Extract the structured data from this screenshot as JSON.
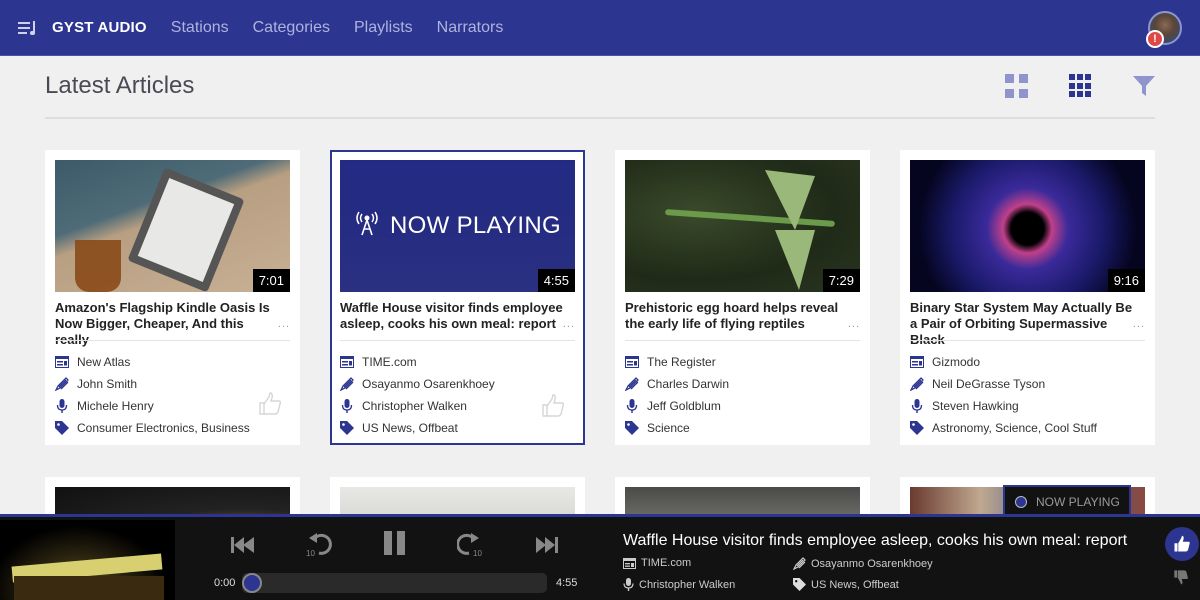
{
  "nav": {
    "brand": "GYST AUDIO",
    "links": [
      "Stations",
      "Categories",
      "Playlists",
      "Narrators"
    ],
    "avatar_alert": "!"
  },
  "page": {
    "title": "Latest Articles"
  },
  "colors": {
    "brand": "#2c3590",
    "nav_link": "#aeb3de",
    "alert": "#e04848"
  },
  "cards": [
    {
      "duration": "7:01",
      "title": "Amazon's Flagship Kindle Oasis Is Now Bigger, Cheaper, And this really",
      "publisher": "New Atlas",
      "author": "John Smith",
      "narrator": "Michele Henry",
      "tags": "Consumer Electronics, Business",
      "ellipsis": "..."
    },
    {
      "duration": "4:55",
      "title": "Waffle House visitor finds employee asleep, cooks his own meal: report",
      "publisher": "TIME.com",
      "author": "Osayanmo Osarenkhoey",
      "narrator": "Christopher Walken",
      "tags": "US News, Offbeat",
      "ellipsis": "...",
      "overlay": "NOW PLAYING"
    },
    {
      "duration": "7:29",
      "title": "Prehistoric egg hoard helps reveal the early life of flying reptiles",
      "publisher": "The Register",
      "author": "Charles Darwin",
      "narrator": "Jeff Goldblum",
      "tags": "Science",
      "ellipsis": "..."
    },
    {
      "duration": "9:16",
      "title": "Binary Star System May Actually Be a Pair of Orbiting Supermassive Black",
      "publisher": "Gizmodo",
      "author": "Neil DeGrasse Tyson",
      "narrator": "Steven Hawking",
      "tags": "Astronomy, Science, Cool Stuff",
      "ellipsis": "..."
    }
  ],
  "player": {
    "tab_label": "NOW PLAYING",
    "title": "Waffle House visitor finds employee asleep, cooks his own meal: report",
    "publisher": "TIME.com",
    "author": "Osayanmo Osarenkhoey",
    "narrator": "Christopher Walken",
    "tags": "US News, Offbeat",
    "elapsed": "0:00",
    "total": "4:55",
    "progress": 0,
    "skip_seconds": "10"
  }
}
